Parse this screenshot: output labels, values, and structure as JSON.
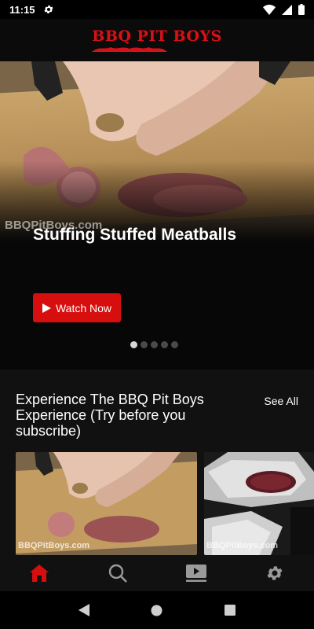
{
  "status_bar": {
    "time": "11:15"
  },
  "header": {
    "logo_text": "BBQ PIT BOYS"
  },
  "hero": {
    "watermark": "BBQPitBoys.com",
    "title": "Stuffing Stuffed Meatballs",
    "watch_label": "Watch Now",
    "carousel_pages": 5,
    "active_page": 1
  },
  "section": {
    "title": "Experience The BBQ Pit Boys Experience (Try before you subscribe)",
    "see_all": "See All",
    "thumbnails": [
      {
        "watermark": "BBQPitBoys.com"
      },
      {
        "watermark": "BBQPitBoys.com"
      }
    ]
  },
  "bottom_nav": {
    "items": [
      {
        "icon": "home-icon",
        "active": true
      },
      {
        "icon": "search-icon",
        "active": false
      },
      {
        "icon": "video-library-icon",
        "active": false
      },
      {
        "icon": "settings-icon",
        "active": false
      }
    ]
  },
  "colors": {
    "accent": "#d70e0e",
    "background": "#000000",
    "nav_active": "#d70e0e",
    "nav_inactive": "#9a9a9a"
  }
}
